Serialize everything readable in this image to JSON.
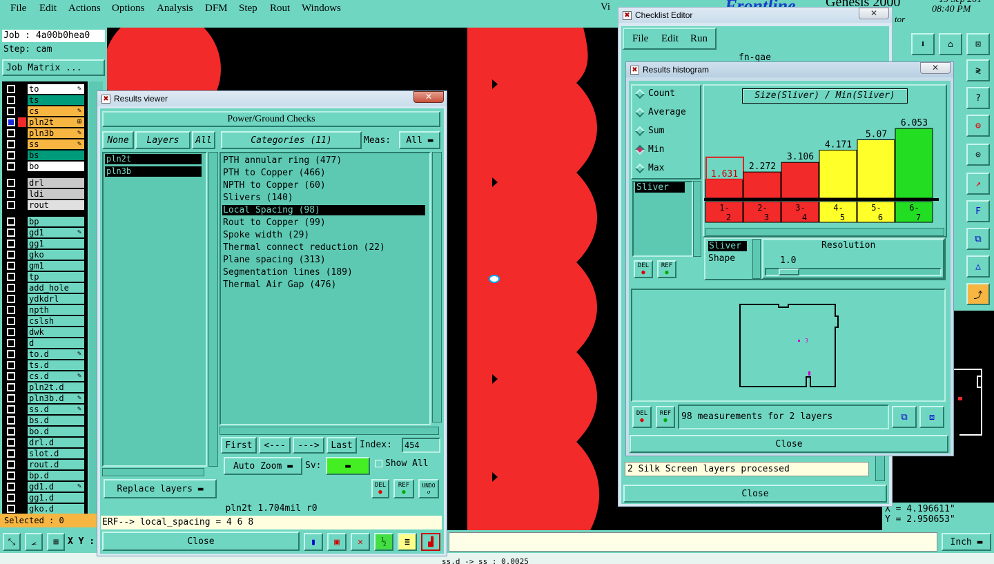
{
  "menubar": {
    "items": [
      "File",
      "Edit",
      "Actions",
      "Options",
      "Analysis",
      "DFM",
      "Step",
      "Rout",
      "Windows"
    ],
    "app": "Genesis 2000",
    "brand": "Frontline",
    "clock_date": "19 Sep 201",
    "clock_time": "08:40 PM",
    "partial": "Vi",
    "sub": "tor"
  },
  "job": {
    "job": "Job : 4a00b0hea0",
    "step": "Step: cam",
    "matrix": "Job Matrix ..."
  },
  "layers": [
    {
      "n": "to",
      "c": "#ffffff",
      "sel": false,
      "m": "✎"
    },
    {
      "n": "ts",
      "c": "#009b7a",
      "sel": false,
      "m": ""
    },
    {
      "n": "cs",
      "c": "#f7b542",
      "sel": false,
      "m": "✎"
    },
    {
      "n": "pln2t",
      "c": "#f7b542",
      "sel": true,
      "m": "⊞"
    },
    {
      "n": "pln3b",
      "c": "#f7b542",
      "sel": false,
      "m": "✎"
    },
    {
      "n": "ss",
      "c": "#f7b542",
      "sel": false,
      "m": "✎"
    },
    {
      "n": "bs",
      "c": "#009b7a",
      "sel": false,
      "m": ""
    },
    {
      "n": "bo",
      "c": "#ffffff",
      "sel": false,
      "m": ""
    },
    {
      "n": "drl",
      "c": "#c9c9c9",
      "sel": false,
      "m": ""
    },
    {
      "n": "ldi",
      "c": "#c9c9c9",
      "sel": false,
      "m": ""
    },
    {
      "n": "rout",
      "c": "#e0e0e0",
      "sel": false,
      "m": ""
    },
    {
      "n": "bp",
      "c": "#6fd6c1",
      "sel": false,
      "m": ""
    },
    {
      "n": "gd1",
      "c": "#6fd6c1",
      "sel": false,
      "m": "✎"
    },
    {
      "n": "gg1",
      "c": "#6fd6c1",
      "sel": false,
      "m": ""
    },
    {
      "n": "gko",
      "c": "#6fd6c1",
      "sel": false,
      "m": ""
    },
    {
      "n": "gm1",
      "c": "#6fd6c1",
      "sel": false,
      "m": ""
    },
    {
      "n": "tp",
      "c": "#6fd6c1",
      "sel": false,
      "m": ""
    },
    {
      "n": "add_hole",
      "c": "#6fd6c1",
      "sel": false,
      "m": ""
    },
    {
      "n": "ydkdrl",
      "c": "#6fd6c1",
      "sel": false,
      "m": ""
    },
    {
      "n": "npth",
      "c": "#6fd6c1",
      "sel": false,
      "m": ""
    },
    {
      "n": "cslsh",
      "c": "#6fd6c1",
      "sel": false,
      "m": ""
    },
    {
      "n": "dwk",
      "c": "#6fd6c1",
      "sel": false,
      "m": ""
    },
    {
      "n": "d",
      "c": "#6fd6c1",
      "sel": false,
      "m": ""
    },
    {
      "n": "to.d",
      "c": "#6fd6c1",
      "sel": false,
      "m": "✎"
    },
    {
      "n": "ts.d",
      "c": "#6fd6c1",
      "sel": false,
      "m": ""
    },
    {
      "n": "cs.d",
      "c": "#6fd6c1",
      "sel": false,
      "m": "✎"
    },
    {
      "n": "pln2t.d",
      "c": "#6fd6c1",
      "sel": false,
      "m": ""
    },
    {
      "n": "pln3b.d",
      "c": "#6fd6c1",
      "sel": false,
      "m": "✎"
    },
    {
      "n": "ss.d",
      "c": "#6fd6c1",
      "sel": false,
      "m": "✎"
    },
    {
      "n": "bs.d",
      "c": "#6fd6c1",
      "sel": false,
      "m": ""
    },
    {
      "n": "bo.d",
      "c": "#6fd6c1",
      "sel": false,
      "m": ""
    },
    {
      "n": "drl.d",
      "c": "#6fd6c1",
      "sel": false,
      "m": ""
    },
    {
      "n": "slot.d",
      "c": "#6fd6c1",
      "sel": false,
      "m": ""
    },
    {
      "n": "rout.d",
      "c": "#6fd6c1",
      "sel": false,
      "m": ""
    },
    {
      "n": "bp.d",
      "c": "#6fd6c1",
      "sel": false,
      "m": ""
    },
    {
      "n": "gd1.d",
      "c": "#6fd6c1",
      "sel": false,
      "m": "✎"
    },
    {
      "n": "gg1.d",
      "c": "#6fd6c1",
      "sel": false,
      "m": ""
    },
    {
      "n": "gko.d",
      "c": "#6fd6c1",
      "sel": false,
      "m": ""
    }
  ],
  "selected": "Selected : 0",
  "xy_label": "X Y :",
  "unit": "Inch",
  "coords": {
    "x": "X = 4.196611\"",
    "y": "Y = 2.950653\""
  },
  "bottom_status": "ss.d -> ss : 0.0025",
  "results_viewer": {
    "title": "Results viewer",
    "header": "Power/Ground Checks",
    "none": "None",
    "layers": "Layers",
    "all": "All",
    "layer_items": [
      "pln2t",
      "pln3b"
    ],
    "categories_btn": "Categories (11)",
    "meas_label": "Meas:",
    "meas_value": "All",
    "categories": [
      "PTH annular ring (477)",
      "PTH to Copper (466)",
      "NPTH to Copper (60)",
      "Slivers (140)",
      "Local Spacing (98)",
      "Rout to Copper (99)",
      "Spoke width (29)",
      "Thermal connect reduction (22)",
      "Plane spacing (313)",
      "Segmentation lines (189)",
      "Thermal Air Gap (476)"
    ],
    "selected_category": 4,
    "first": "First",
    "prev": "<---",
    "next": "--->",
    "last": "Last",
    "index_label": "Index:",
    "index_value": "454",
    "auto_zoom": "Auto Zoom",
    "sv_label": "Sv:",
    "show_all": "Show All",
    "replace_layers": "Replace layers",
    "del": "DEL",
    "ref": "REF",
    "undo": "UNDO",
    "status": "pln2t 1.704mil  r0",
    "erf": "ERF--> local_spacing = 4 6 8",
    "close": "Close"
  },
  "checklist_editor": {
    "title": "Checklist Editor",
    "menu": [
      "File",
      "Edit",
      "Run"
    ],
    "partial": "fn-gae",
    "msg": "2 Silk Screen layers processed",
    "close": "Close"
  },
  "histogram": {
    "title": "Results histogram",
    "modes": [
      "Count",
      "Average",
      "Sum",
      "Min",
      "Max"
    ],
    "active_mode": 3,
    "chart_title": "Size(Sliver) / Min(Sliver)",
    "list_item": "Sliver",
    "del": "DEL",
    "ref": "REF",
    "shape_items": [
      "Sliver",
      "Shape"
    ],
    "resolution_label": "Resolution",
    "resolution_value": "1.0",
    "measurements": "98 measurements for 2 layers",
    "close": "Close"
  },
  "chart_data": {
    "type": "bar",
    "categories": [
      "1-2",
      "2-3",
      "3-4",
      "4-5",
      "5-6",
      "6-7"
    ],
    "values": [
      1.631,
      2.272,
      3.106,
      4.171,
      5.07,
      6.053
    ],
    "colors": [
      "#f22a2a",
      "#f22a2a",
      "#f22a2a",
      "#ffff2a",
      "#ffff2a",
      "#22dd22"
    ],
    "title": "Size(Sliver) / Min(Sliver)",
    "ylim": [
      0,
      6.6
    ],
    "highlighted": 0
  }
}
